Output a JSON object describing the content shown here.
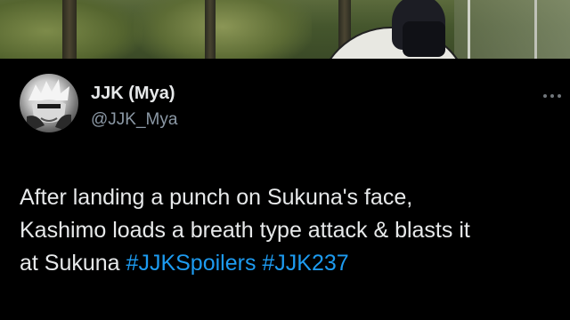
{
  "author": {
    "display_name": "JJK (Mya)",
    "handle": "@JJK_Mya"
  },
  "icons": {
    "more": "more-options-icon"
  },
  "tweet": {
    "line1": "After landing a punch on Sukuna's face,",
    "line2": "Kashimo loads a breath type attack & blasts it",
    "line3_prefix": "at Sukuna",
    "hashtags": [
      "#JJKSpoilers",
      "#JJK237"
    ]
  },
  "colors": {
    "background": "#000000",
    "text": "#e7e9ea",
    "secondary_text": "#8b98a5",
    "link": "#1d9bf0"
  }
}
